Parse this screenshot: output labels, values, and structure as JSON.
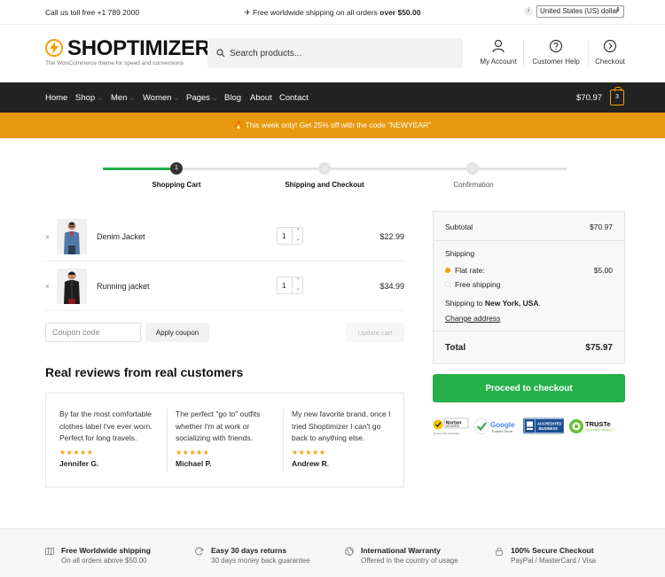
{
  "topbar": {
    "call": "Call us toll free +1 789 2000",
    "shipping_prefix": "✈ Free worldwide shipping on all orders ",
    "shipping_bold": "over $50.00",
    "info_glyph": "i",
    "currency": "United States (US) dollar"
  },
  "header": {
    "logo": "SHOPTIMIZER",
    "tagline": "The WooCommerce theme for speed and conversions",
    "search_placeholder": "Search products...",
    "links": [
      {
        "label": "My Account",
        "icon": "user-icon"
      },
      {
        "label": "Customer Help",
        "icon": "help-icon"
      },
      {
        "label": "Checkout",
        "icon": "arrow-right-circle-icon"
      }
    ]
  },
  "nav": {
    "items": [
      {
        "label": "Home"
      },
      {
        "label": "Shop",
        "chevron": "⌵"
      },
      {
        "label": "Men",
        "chevron": "⌵"
      },
      {
        "label": "Women",
        "chevron": "⌵"
      },
      {
        "label": "Pages",
        "chevron": "⌵"
      },
      {
        "label": "Blog"
      },
      {
        "label": "About"
      },
      {
        "label": "Contact"
      }
    ],
    "cart_total": "$70.97",
    "cart_count": "3"
  },
  "promo": "🔥 This week only! Get 25% off with the code \"NEWYEAR\"",
  "steps": [
    {
      "number": "1",
      "label": "Shopping Cart",
      "state": "active"
    },
    {
      "number": "2",
      "label": "Shipping and Checkout",
      "state": "upcoming"
    },
    {
      "number": "3",
      "label": "Confirmation",
      "state": "upcoming"
    }
  ],
  "cart": {
    "items": [
      {
        "name": "Denim Jacket",
        "qty": "1",
        "price": "$22.99"
      },
      {
        "name": "Running jacket",
        "qty": "1",
        "price": "$34.99"
      }
    ],
    "remove_glyph": "×",
    "stepper_up": "⌃",
    "stepper_down": "⌄",
    "coupon_placeholder": "Coupon code",
    "apply_label": "Apply coupon",
    "update_label": "Update cart"
  },
  "reviews": {
    "title": "Real reviews from real customers",
    "items": [
      {
        "text": "By far the most comfortable clothes label I've ever worn. Perfect for long travels.",
        "stars": "★★★★★",
        "author": "Jennifer G."
      },
      {
        "text": "The perfect \"go to\" outfits whether I'm at work or socializing with friends.",
        "stars": "★★★★★",
        "author": "Michael P."
      },
      {
        "text": "My new favorite brand, once I tried Shoptimizer I can't go back to anything else.",
        "stars": "★★★★★",
        "author": "Andrew R."
      }
    ]
  },
  "summary": {
    "subtotal_label": "Subtotal",
    "subtotal": "$70.97",
    "shipping_label": "Shipping",
    "flat_rate_label": "Flat rate:",
    "flat_rate": "$5.00",
    "free_shipping_label": "Free shipping",
    "ship_to_prefix": "Shipping to ",
    "ship_to_place": "New York, USA",
    "ship_to_suffix": ".",
    "change_address": "Change address",
    "total_label": "Total",
    "total": "$75.97",
    "checkout_label": "Proceed to checkout",
    "badges": {
      "norton": "Norton",
      "norton_sub": "SECURED",
      "norton_powered": "powered by Symantec",
      "google": "Google",
      "google_sub": "Trusted Store",
      "bbb_a": "ACCREDITED",
      "bbb_b": "BUSINESS",
      "truste": "TRUSTe",
      "truste_sub": "CERTIFIED PRIVACY"
    }
  },
  "footer": [
    {
      "title": "Free Worldwide shipping",
      "sub": "On all orders above $50.00",
      "icon": "map-icon"
    },
    {
      "title": "Easy 30 days returns",
      "sub": "30 days money back guarantee",
      "icon": "refresh-icon"
    },
    {
      "title": "International Warranty",
      "sub": "Offered in the country of usage",
      "icon": "globe-icon"
    },
    {
      "title": "100% Secure Checkout",
      "sub": "PayPal / MasterCard / Visa",
      "icon": "lock-icon"
    }
  ],
  "colors": {
    "accent": "#e8980e",
    "checkout": "#25b04a",
    "nav_bg": "#222222",
    "progress_done": "#25b04a"
  }
}
